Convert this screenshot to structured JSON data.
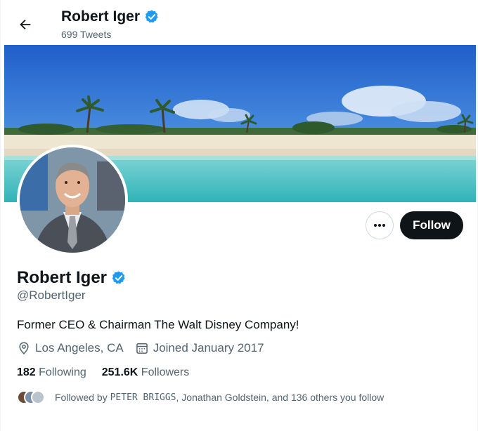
{
  "header": {
    "name": "Robert Iger",
    "tweet_count": "699 Tweets"
  },
  "profile": {
    "name": "Robert Iger",
    "handle": "@RobertIger",
    "bio": "Former CEO & Chairman The Walt Disney Company!",
    "location": "Los Angeles, CA",
    "joined": "Joined January 2017",
    "following_count": "182",
    "following_label": "Following",
    "followers_count": "251.6K",
    "followers_label": "Followers",
    "followed_by_prefix": "Followed by ",
    "followed_by_mono": "PETER BRIGGS",
    "followed_by_suffix": ", Jonathan Goldstein, and 136 others you follow"
  },
  "actions": {
    "follow_label": "Follow",
    "more_label": "•••"
  },
  "colors": {
    "verified": "#1d9bf0",
    "follow_bg": "#0f1419",
    "secondary_text": "#536471"
  },
  "icons": {
    "back": "arrow-left-icon",
    "verified": "verified-badge-icon",
    "location": "location-pin-icon",
    "calendar": "calendar-icon",
    "more": "more-dots-icon"
  }
}
